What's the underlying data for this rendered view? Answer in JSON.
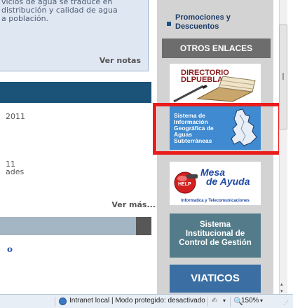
{
  "left_panel": {
    "notes_text": "vicios de agua se traduce en\ndistribución y calidad de agua\na población.",
    "ver_notas": "Ver notas",
    "item_year": "2011",
    "item_11": "11",
    "item_ades": "ades",
    "ver_mas": "Ver más...",
    "letter_o": "o"
  },
  "sidebar": {
    "promo": "Promociones y\nDescuentos",
    "otros_enlaces": "OTROS ENLACES",
    "directorio": {
      "line1": "DIRECTORIO",
      "line2": "DLPUEBLA"
    },
    "sigas": "Sistema de\nInformación\nGeográfica de\nAguas\nSubterráneas",
    "mesa": {
      "line1": "Mesa",
      "line2": "de Ayuda",
      "subtitle": "Informatica y Telecomunicaciones",
      "badge": "HELP"
    },
    "sistema": "Sistema\nInstitucional de\nControl de Gestión",
    "viaticos": "VIATICOS"
  },
  "statusbar": {
    "zone": "Intranet local | Modo protegido: desactivado",
    "zoom": "150%",
    "addon_glyph": "✍",
    "zoom_glyph": "🔍",
    "arrow": "▾",
    "grip": "⋰"
  },
  "scrollbar": {
    "up": "▴",
    "down": "▾"
  },
  "icons": {
    "bullet": "bullet-square-icon",
    "zone": "intranet-globe-icon",
    "addon": "pen-addon-icon",
    "zoom": "zoom-magnifier-icon"
  },
  "colors": {
    "highlight": "#ea1c1c",
    "header_band": "#1b5277",
    "sidebar_bg": "#d3d3d3",
    "sigas_bg": "#3f8ad0"
  }
}
